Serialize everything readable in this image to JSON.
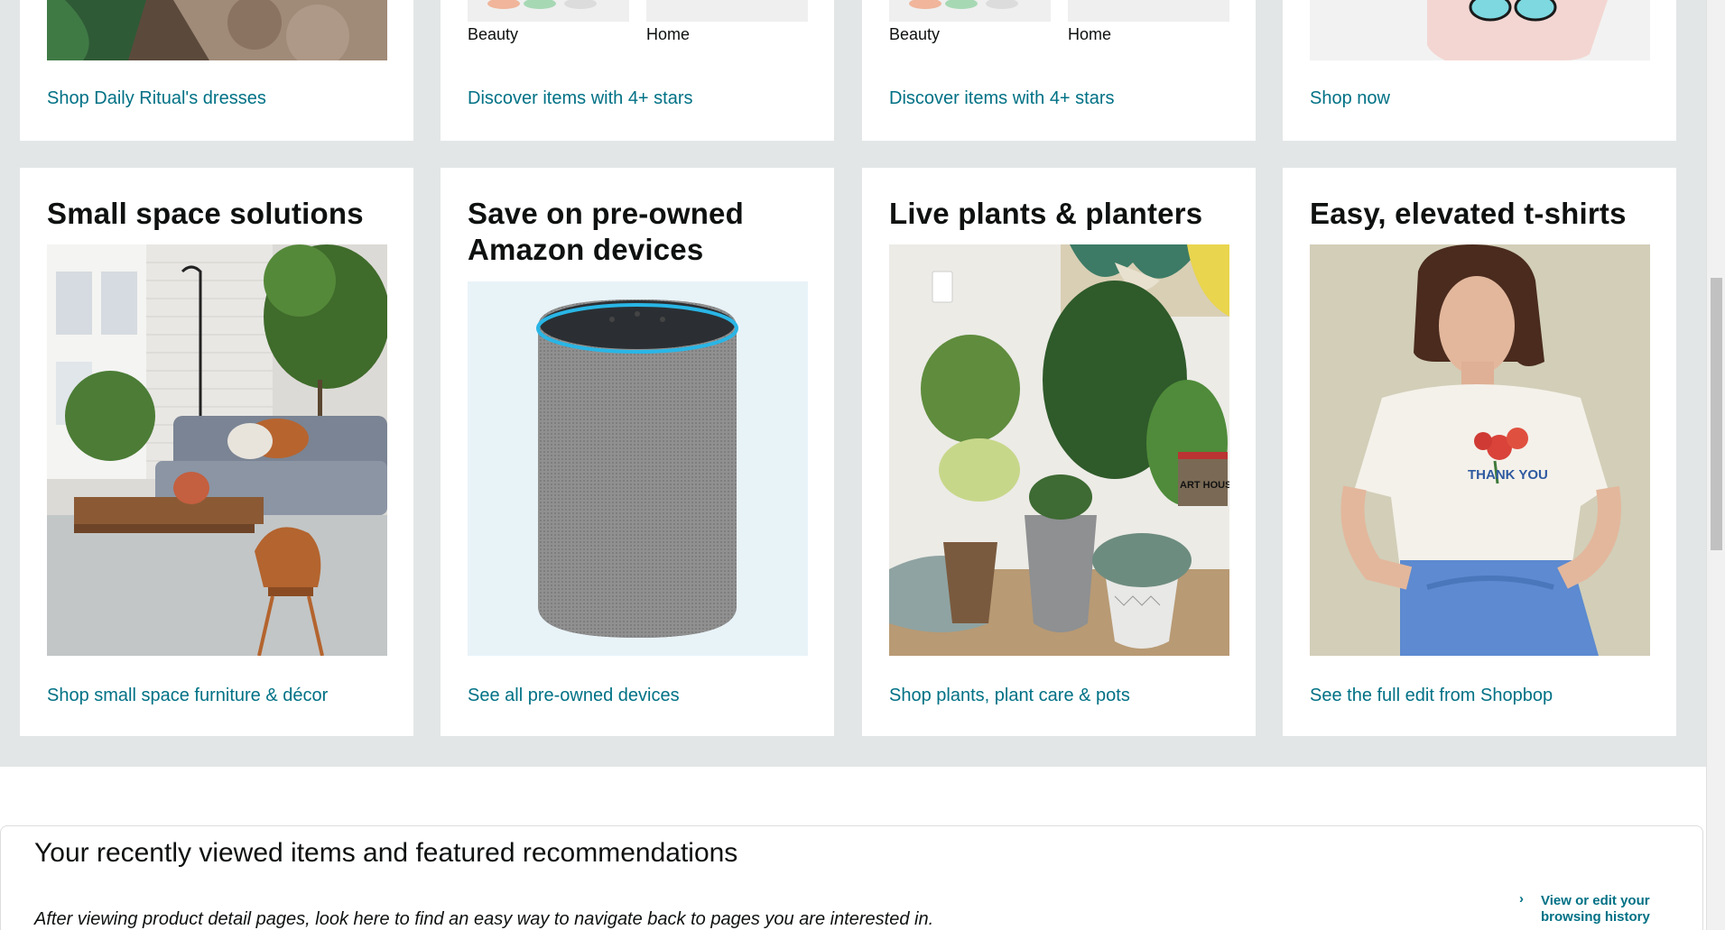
{
  "top_row": [
    {
      "link": "Shop Daily Ritual's dresses"
    },
    {
      "labels": [
        "Beauty",
        "Home"
      ],
      "link": "Discover items with 4+ stars"
    },
    {
      "labels": [
        "Beauty",
        "Home"
      ],
      "link": "Discover items with 4+ stars"
    },
    {
      "link": "Shop now"
    }
  ],
  "cards": [
    {
      "title": "Small space solutions",
      "link": "Shop small space furniture & décor"
    },
    {
      "title": "Save on pre-owned Amazon devices",
      "link": "See all pre-owned devices"
    },
    {
      "title": "Live plants & planters",
      "link": "Shop plants, plant care & pots"
    },
    {
      "title": "Easy, elevated t-shirts",
      "link": "See the full edit from Shopbop"
    }
  ],
  "recent": {
    "title": "Your recently viewed items and featured recommendations",
    "description": "After viewing product detail pages, look here to find an easy way to navigate back to pages you are interested in.",
    "side_link": "View or edit your browsing history",
    "chevron": "›"
  },
  "tshirt_text": "THANK YOU",
  "book_text": "ART HOUSE",
  "colors": {
    "link": "#007185",
    "background": "#e3e6e6",
    "text": "#0f1111"
  }
}
